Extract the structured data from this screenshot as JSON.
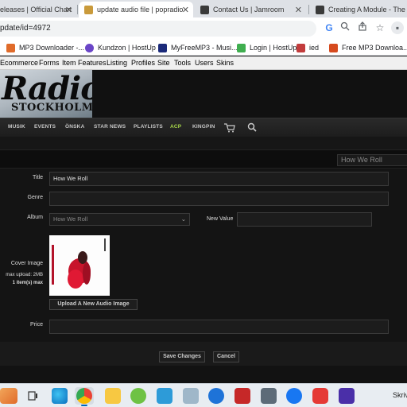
{
  "browser": {
    "tabs": [
      {
        "title": "eleases | Official Chart",
        "fav_color": "#2e2e2e",
        "active": false
      },
      {
        "title": "update audio file | popradio",
        "fav_color": "#c99a3b",
        "active": true
      },
      {
        "title": "Contact Us | Jamroom",
        "fav_color": "#3a3a3a",
        "active": false
      },
      {
        "title": "Creating A Module - The Jam",
        "fav_color": "#3a3a3a",
        "active": false
      }
    ],
    "url": "pdate/id=4972",
    "bookmarks": [
      {
        "label": "MP3 Downloader -...",
        "fav_color": "#e06b2a"
      },
      {
        "label": "Kundzon | HostUp",
        "fav_color": "#6a45c7"
      },
      {
        "label": "MyFreeMP3 - Musi...",
        "fav_color": "#1b2a7a"
      },
      {
        "label": "Login | HostUp",
        "fav_color": "#3fae4f"
      },
      {
        "label": "ied",
        "fav_color": "#c23c3c"
      },
      {
        "label": "Free MP3 Downloa...",
        "fav_color": "#d64a1e"
      }
    ]
  },
  "site_menu": [
    "Ecommerce",
    "Forms",
    "Item Features",
    "Listing",
    "Profiles",
    "Site",
    "Tools",
    "Users",
    "Skins"
  ],
  "logo": {
    "line1": "Radio",
    "line2": "STOCKHOLM"
  },
  "nav": [
    {
      "label": "MUSIK",
      "active": false
    },
    {
      "label": "EVENTS",
      "active": false
    },
    {
      "label": "ÖNSKA",
      "active": false
    },
    {
      "label": "STAR NEWS",
      "active": false
    },
    {
      "label": "PLAYLISTS",
      "active": false
    },
    {
      "label": "ACP",
      "active": true
    },
    {
      "label": "KINGPIN",
      "active": false
    }
  ],
  "subbar": {
    "selected": "How We Roll"
  },
  "form": {
    "title_label": "Title",
    "title_value": "How We Roll",
    "genre_label": "Genre",
    "genre_value": "",
    "album_label": "Album",
    "album_value": "How We Roll",
    "new_value_label": "New Value",
    "new_value_value": "",
    "cover_label": "Cover Image",
    "max_upload": "max upload: 2MB",
    "max_items": "1 item(s) max",
    "upload_button": "Upload A New Audio Image",
    "price_label": "Price",
    "price_value": "",
    "save_button": "Save Changes",
    "cancel_button": "Cancel"
  },
  "taskbar": {
    "right_text": "Skriv"
  },
  "colors": {
    "accent_nav_active": "#a8d84a",
    "bg": "#141414"
  }
}
